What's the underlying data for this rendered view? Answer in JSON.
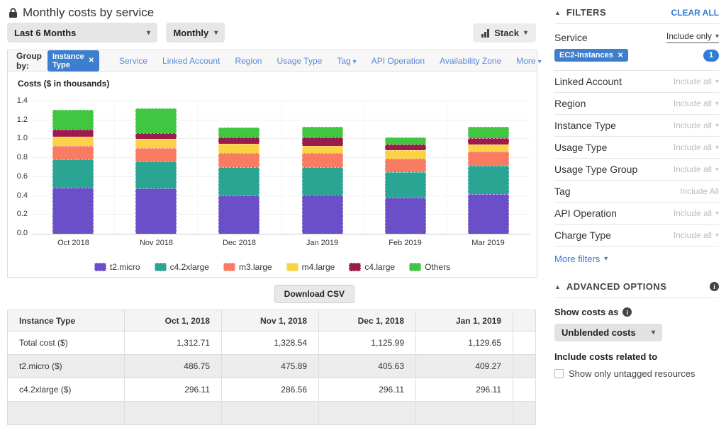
{
  "header": {
    "title": "Monthly costs by service"
  },
  "controls": {
    "date_range": "Last 6 Months",
    "granularity": "Monthly",
    "chart_style": "Stack"
  },
  "group_by": {
    "label": "Group by:",
    "selected": "Instance Type",
    "options": [
      {
        "label": "Service",
        "caret": false
      },
      {
        "label": "Linked Account",
        "caret": false
      },
      {
        "label": "Region",
        "caret": false
      },
      {
        "label": "Usage Type",
        "caret": false
      },
      {
        "label": "Tag",
        "caret": true
      },
      {
        "label": "API Operation",
        "caret": false
      },
      {
        "label": "Availability Zone",
        "caret": false
      }
    ],
    "more_label": "More",
    "more_caret": true
  },
  "chart_data": {
    "type": "bar",
    "stacked": true,
    "title": "Costs ($ in thousands)",
    "categories": [
      "Oct 2018",
      "Nov 2018",
      "Dec 2018",
      "Jan 2019",
      "Feb 2019",
      "Mar 2019"
    ],
    "series": [
      {
        "name": "t2.micro",
        "color": "#6b4fc8",
        "values": [
          0.487,
          0.476,
          0.406,
          0.409,
          0.381,
          0.42
        ]
      },
      {
        "name": "c4.2xlarge",
        "color": "#2aa593",
        "values": [
          0.296,
          0.287,
          0.296,
          0.296,
          0.274,
          0.3
        ]
      },
      {
        "name": "m3.large",
        "color": "#f97b62",
        "values": [
          0.146,
          0.142,
          0.148,
          0.15,
          0.135,
          0.146
        ]
      },
      {
        "name": "m4.large",
        "color": "#fbd145",
        "values": [
          0.1,
          0.095,
          0.103,
          0.077,
          0.09,
          0.08
        ]
      },
      {
        "name": "c4.large",
        "color": "#9b1b4d",
        "values": [
          0.071,
          0.067,
          0.069,
          0.09,
          0.064,
          0.066
        ]
      },
      {
        "name": "Others",
        "color": "#41c642",
        "values": [
          0.213,
          0.262,
          0.104,
          0.108,
          0.078,
          0.118
        ]
      }
    ],
    "ylim": [
      0,
      1.4
    ],
    "ytick_step": 0.2,
    "grid": true,
    "legend_position": "bottom"
  },
  "csv_button_label": "Download CSV",
  "table": {
    "columns": [
      "Instance Type",
      "Oct 1, 2018",
      "Nov 1, 2018",
      "Dec 1, 2018",
      "Jan 1, 2019"
    ],
    "rows": [
      [
        "Total cost ($)",
        "1,312.71",
        "1,328.54",
        "1,125.99",
        "1,129.65"
      ],
      [
        "t2.micro ($)",
        "486.75",
        "475.89",
        "405.63",
        "409.27"
      ],
      [
        "c4.2xlarge ($)",
        "296.11",
        "286.56",
        "296.11",
        "296.11"
      ]
    ],
    "shaded_row_indexes": [
      1
    ]
  },
  "sidebar": {
    "filters_title": "FILTERS",
    "clear_all_label": "CLEAR ALL",
    "service": {
      "label": "Service",
      "mode": "Include only",
      "chip": "EC2-Instances",
      "count": "1"
    },
    "filter_rows": [
      {
        "label": "Linked Account",
        "value": "Include all",
        "caret": true
      },
      {
        "label": "Region",
        "value": "Include all",
        "caret": true
      },
      {
        "label": "Instance Type",
        "value": "Include all",
        "caret": true
      },
      {
        "label": "Usage Type",
        "value": "Include all",
        "caret": true
      },
      {
        "label": "Usage Type Group",
        "value": "Include all",
        "caret": true
      },
      {
        "label": "Tag",
        "value": "Include All",
        "caret": false
      },
      {
        "label": "API Operation",
        "value": "Include all",
        "caret": true
      },
      {
        "label": "Charge Type",
        "value": "Include all",
        "caret": true
      }
    ],
    "more_filters_label": "More filters",
    "advanced_title": "ADVANCED OPTIONS",
    "show_costs_as_label": "Show costs as",
    "costs_dropdown_value": "Unblended costs",
    "include_costs_label": "Include costs related to",
    "untagged_checkbox_label": "Show only untagged resources",
    "untagged_checked": false
  },
  "colors": {
    "chip_blue": "#3e7ecf",
    "link_blue": "#5a8ad8",
    "action_blue": "#2e7cd6",
    "muted_gray": "#bcbcbc"
  }
}
